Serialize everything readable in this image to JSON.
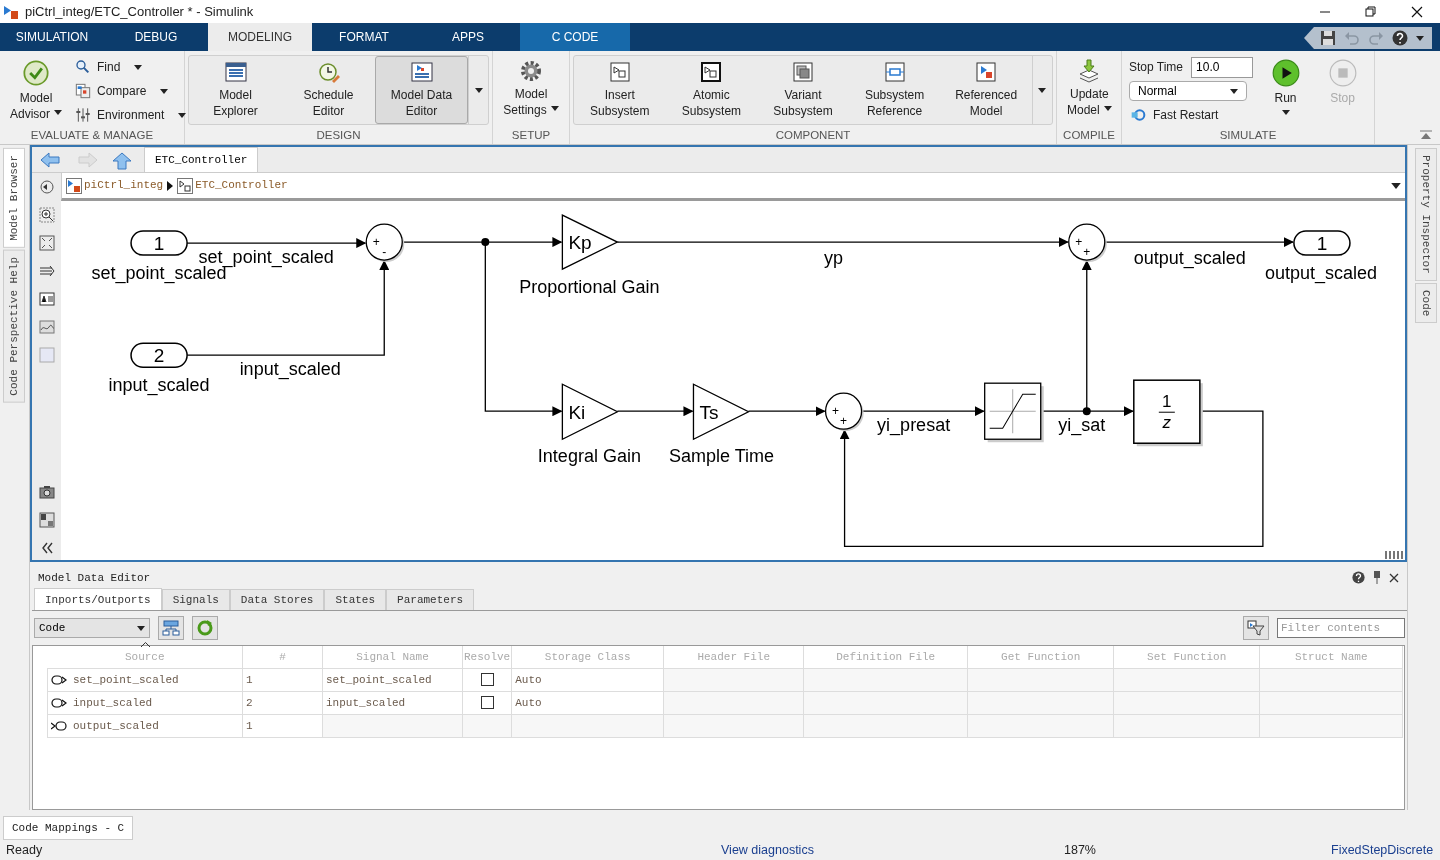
{
  "window": {
    "title": "piCtrl_integ/ETC_Controller * - Simulink"
  },
  "ribbon": {
    "tabs": [
      {
        "label": "SIMULATION",
        "selected": false,
        "kind": "standard"
      },
      {
        "label": "DEBUG",
        "selected": false,
        "kind": "standard"
      },
      {
        "label": "MODELING",
        "selected": true,
        "kind": "standard"
      },
      {
        "label": "FORMAT",
        "selected": false,
        "kind": "standard"
      },
      {
        "label": "APPS",
        "selected": false,
        "kind": "standard"
      },
      {
        "label": "C CODE",
        "selected": false,
        "kind": "contextual"
      }
    ],
    "groups": [
      {
        "label": "EVALUATE & MANAGE",
        "gallery": false,
        "items": [
          {
            "kind": "large",
            "lines": [
              "Model",
              "Advisor"
            ],
            "dropdown": true
          },
          {
            "kind": "small",
            "label": "Find",
            "dropdown": true
          },
          {
            "kind": "small",
            "label": "Compare",
            "dropdown": true
          },
          {
            "kind": "small",
            "label": "Environment",
            "dropdown": true
          }
        ]
      },
      {
        "label": "DESIGN",
        "gallery": true,
        "items": [
          {
            "kind": "large",
            "lines": [
              "Model",
              "Explorer"
            ],
            "pressed": false
          },
          {
            "kind": "large",
            "lines": [
              "Schedule",
              "Editor"
            ],
            "pressed": false
          },
          {
            "kind": "large",
            "lines": [
              "Model Data",
              "Editor"
            ],
            "pressed": true
          }
        ]
      },
      {
        "label": "SETUP",
        "gallery": false,
        "items": [
          {
            "kind": "large",
            "lines": [
              "Model",
              "Settings"
            ],
            "dropdown": true
          }
        ]
      },
      {
        "label": "COMPONENT",
        "gallery": true,
        "items": [
          {
            "kind": "large",
            "lines": [
              "Insert",
              "Subsystem"
            ]
          },
          {
            "kind": "large",
            "lines": [
              "Atomic",
              "Subsystem"
            ]
          },
          {
            "kind": "large",
            "lines": [
              "Variant",
              "Subsystem"
            ]
          },
          {
            "kind": "large",
            "lines": [
              "Subsystem",
              "Reference"
            ]
          },
          {
            "kind": "large",
            "lines": [
              "Referenced",
              "Model"
            ]
          }
        ]
      },
      {
        "label": "COMPILE",
        "gallery": false,
        "items": [
          {
            "kind": "large",
            "lines": [
              "Update",
              "Model"
            ],
            "dropdown": true
          }
        ]
      },
      {
        "label": "SIMULATE",
        "gallery": false,
        "items": [
          {
            "kind": "stop_time",
            "label": "Stop Time",
            "value": "10.0"
          },
          {
            "kind": "select",
            "value": "Normal"
          },
          {
            "kind": "toggle",
            "label": "Fast Restart"
          },
          {
            "kind": "large",
            "lines": [
              "Run"
            ],
            "dropdown": true,
            "disabled": false
          },
          {
            "kind": "large",
            "lines": [
              "Stop"
            ],
            "disabled": true
          }
        ]
      }
    ]
  },
  "side_tabs_left": [
    {
      "label": "Model Browser",
      "selected": true
    },
    {
      "label": "Code Perspective Help",
      "selected": false
    }
  ],
  "side_tabs_right": [
    {
      "label": "Property Inspector",
      "selected": false
    },
    {
      "label": "Code",
      "selected": false
    }
  ],
  "editor": {
    "nav": [
      {
        "kind": "back",
        "disabled": false
      },
      {
        "kind": "forward",
        "disabled": true
      },
      {
        "kind": "up",
        "disabled": false
      }
    ],
    "tabs": [
      {
        "label": "ETC_Controller",
        "selected": true
      }
    ],
    "breadcrumb": [
      {
        "label": "piCtrl_integ",
        "kind": "model"
      },
      {
        "label": "ETC_Controller",
        "kind": "subsystem"
      }
    ],
    "diagram": {
      "blocks": [
        {
          "kind": "inport",
          "text": "1",
          "name": "set_point_scaled"
        },
        {
          "kind": "inport",
          "text": "2",
          "name": "input_scaled"
        },
        {
          "kind": "sum",
          "signs": [
            "+",
            "-"
          ]
        },
        {
          "kind": "gain",
          "text": "Kp",
          "name": "Proportional Gain"
        },
        {
          "kind": "gain",
          "text": "Ki",
          "name": "Integral Gain"
        },
        {
          "kind": "gain",
          "text": "Ts",
          "name": "Sample Time"
        },
        {
          "kind": "sum",
          "signs": [
            "+",
            "+"
          ]
        },
        {
          "kind": "saturation"
        },
        {
          "kind": "sum",
          "signs": [
            "+",
            "+"
          ]
        },
        {
          "kind": "unit_delay",
          "numerator": "1",
          "denominator": "z"
        },
        {
          "kind": "outport",
          "text": "1",
          "name": "output_scaled"
        }
      ],
      "signal_labels": [
        "set_point_scaled",
        "input_scaled",
        "yp",
        "output_scaled",
        "yi_presat",
        "yi_sat"
      ]
    }
  },
  "model_data_editor": {
    "title": "Model Data Editor",
    "tabs": [
      {
        "label": "Inports/Outports",
        "selected": true
      },
      {
        "label": "Signals",
        "selected": false
      },
      {
        "label": "Data Stores",
        "selected": false
      },
      {
        "label": "States",
        "selected": false
      },
      {
        "label": "Parameters",
        "selected": false
      }
    ],
    "view": "Code",
    "filter": {
      "placeholder": "Filter contents"
    },
    "columns": [
      {
        "label": "Source",
        "sorted": true
      },
      {
        "label": "#",
        "sorted": false
      },
      {
        "label": "Signal Name",
        "sorted": false
      },
      {
        "label": "Resolve",
        "sorted": false
      },
      {
        "label": "Storage Class",
        "sorted": false
      },
      {
        "label": "Header File",
        "sorted": false
      },
      {
        "label": "Definition File",
        "sorted": false
      },
      {
        "label": "Get Function",
        "sorted": false
      },
      {
        "label": "Set Function",
        "sorted": false
      },
      {
        "label": "Struct Name",
        "sorted": false
      }
    ],
    "rows": [
      {
        "kind": "inport",
        "source": "set_point_scaled",
        "number": "1",
        "signal_name": "set_point_scaled",
        "resolve": false,
        "storage_class": "Auto"
      },
      {
        "kind": "inport",
        "source": "input_scaled",
        "number": "2",
        "signal_name": "input_scaled",
        "resolve": false,
        "storage_class": "Auto"
      },
      {
        "kind": "outport",
        "source": "output_scaled",
        "number": "1"
      }
    ]
  },
  "bottom_tab": "Code Mappings - C",
  "status_bar": {
    "message": "Ready",
    "diagnostics": "View diagnostics",
    "zoom": "187%",
    "solver": "FixedStepDiscrete"
  }
}
